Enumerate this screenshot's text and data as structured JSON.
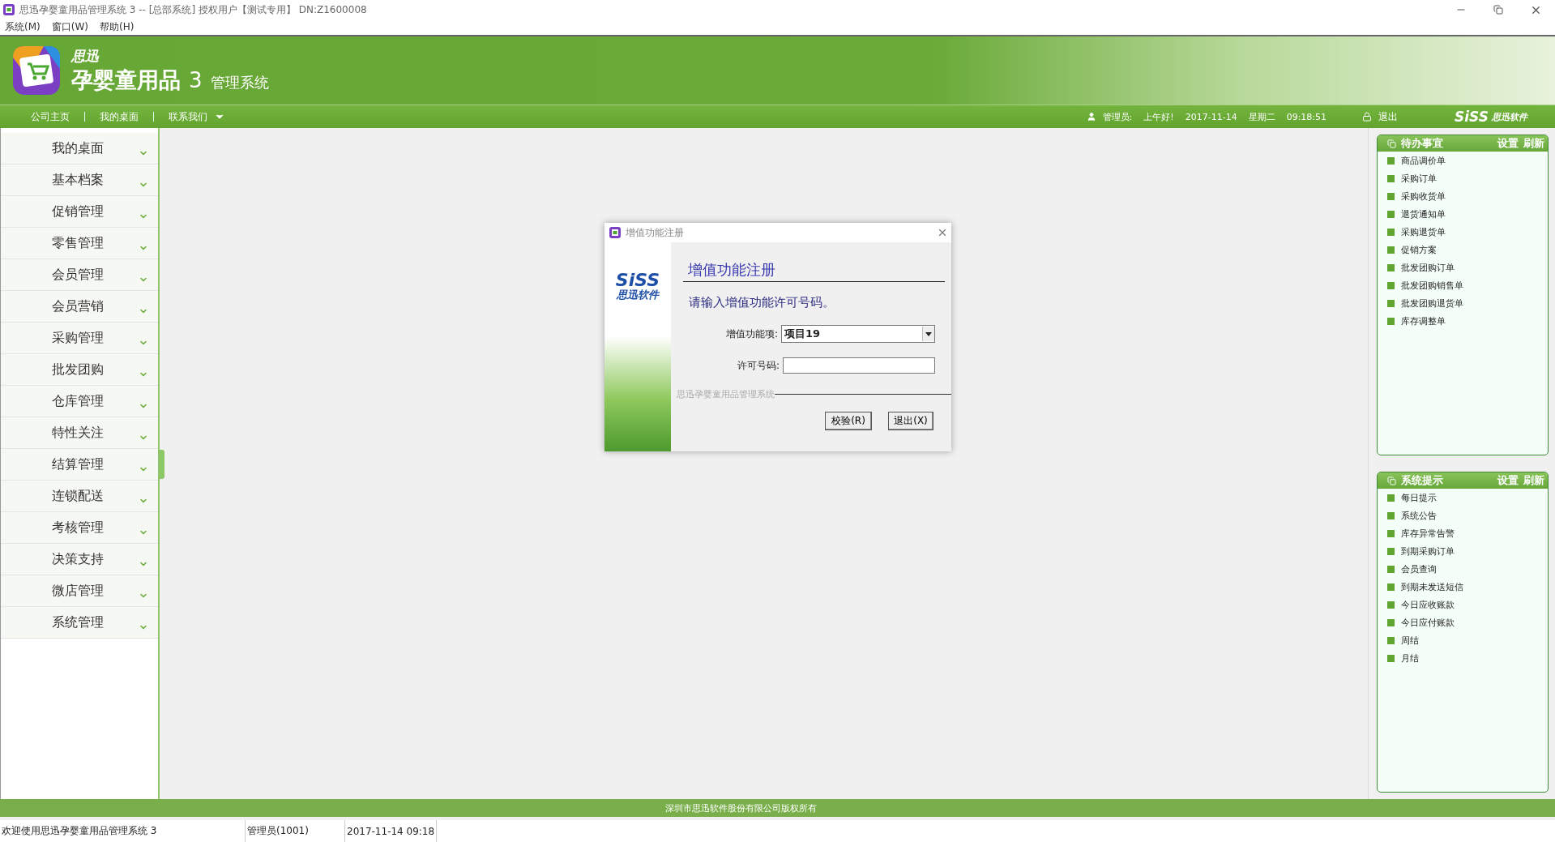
{
  "window": {
    "title": "思迅孕婴童用品管理系统 3 -- [总部系统] 授权用户【测试专用】 DN:Z1600008"
  },
  "menu": [
    "系统(M)",
    "窗口(W)",
    "帮助(H)"
  ],
  "header": {
    "brand_small": "思迅",
    "brand_main": "孕婴童用品",
    "version": "3",
    "subtitle": "管理系统"
  },
  "nav": {
    "links": [
      "公司主页",
      "我的桌面",
      "联系我们"
    ],
    "user": "管理员:",
    "greeting": "上午好!",
    "date": "2017-11-14",
    "weekday": "星期二",
    "time": "09:18:51",
    "logout": "退出",
    "logo_main": "SiSS",
    "logo_sub": "思迅软件"
  },
  "sidebar": {
    "items": [
      "我的桌面",
      "基本档案",
      "促销管理",
      "零售管理",
      "会员管理",
      "会员营销",
      "采购管理",
      "批发团购",
      "仓库管理",
      "特性关注",
      "结算管理",
      "连锁配送",
      "考核管理",
      "决策支持",
      "微店管理",
      "系统管理"
    ]
  },
  "panels": [
    {
      "title": "待办事宜",
      "actions": [
        "设置",
        "刷新"
      ],
      "items": [
        "商品调价单",
        "采购订单",
        "采购收货单",
        "退货通知单",
        "采购退货单",
        "促销方案",
        "批发团购订单",
        "批发团购销售单",
        "批发团购退货单",
        "库存调整单"
      ]
    },
    {
      "title": "系统提示",
      "actions": [
        "设置",
        "刷新"
      ],
      "items": [
        "每日提示",
        "系统公告",
        "库存异常告警",
        "到期采购订单",
        "会员查询",
        "到期未发送短信",
        "今日应收账款",
        "今日应付账款",
        "周结",
        "月结"
      ]
    }
  ],
  "dialog": {
    "title": "增值功能注册",
    "logo_main": "SiSS",
    "logo_sub": "思迅软件",
    "heading": "增值功能注册",
    "prompt": "请输入增值功能许可号码。",
    "fields": [
      {
        "kind": "select",
        "label": "增值功能项:",
        "value": "项目19"
      },
      {
        "kind": "text",
        "label": "许可号码:"
      }
    ],
    "group_label": "思迅孕婴童用品管理系统",
    "buttons": [
      "校验(R)",
      "退出(X)"
    ]
  },
  "footer": {
    "copyright": "深圳市思迅软件股份有限公司版权所有"
  },
  "status_bar": [
    "欢迎使用思迅孕婴童用品管理系统 3",
    "管理员(1001)",
    "2017-11-14 09:18"
  ]
}
